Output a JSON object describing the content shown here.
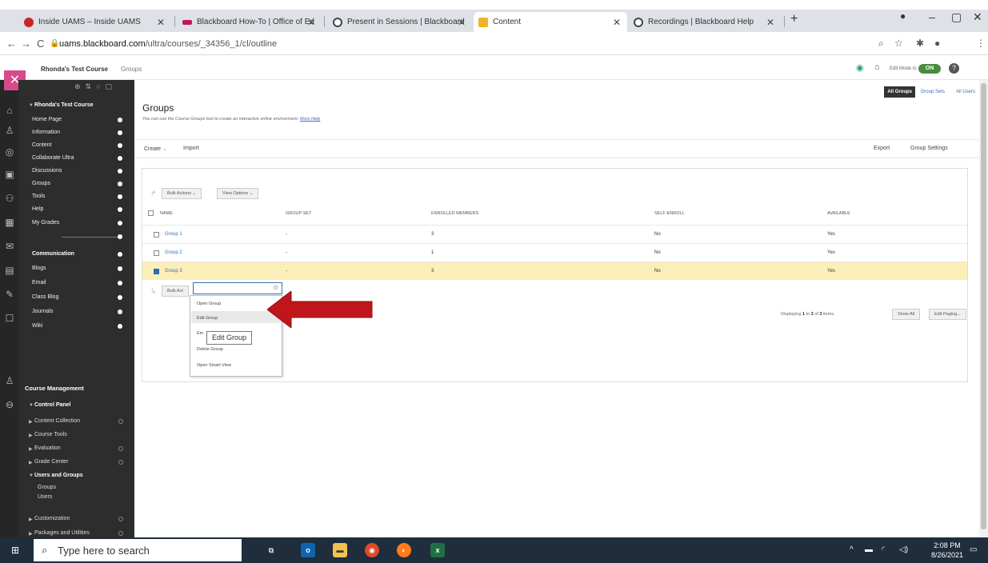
{
  "browser": {
    "tabs": [
      {
        "title": "Inside UAMS – Inside UAMS",
        "favicon_color": "#c62828"
      },
      {
        "title": "Blackboard How-To | Office of Ed",
        "favicon_color": "#c2185b"
      },
      {
        "title": "Present in Sessions | Blackboard",
        "favicon_color": "#444444"
      },
      {
        "title": "Content",
        "favicon_color": "#f0b429"
      },
      {
        "title": "Recordings | Blackboard Help",
        "favicon_color": "#444444"
      }
    ],
    "url_host": "uams.blackboard.com",
    "url_path": "/ultra/courses/_34356_1/cl/outline"
  },
  "course_header": {
    "course_name": "Rhonda's Test Course",
    "breadcrumb": "Groups",
    "edit_mode_label": "Edit Mode is:",
    "edit_mode_state": "ON"
  },
  "course_menu": {
    "title": "Rhonda's Test Course",
    "items": [
      {
        "label": "Home Page"
      },
      {
        "label": "Information"
      },
      {
        "label": "Content"
      },
      {
        "label": "Collaborate Ultra"
      },
      {
        "label": "Discussions"
      },
      {
        "label": "Groups"
      },
      {
        "label": "Tools"
      },
      {
        "label": "Help"
      },
      {
        "label": "My Grades"
      }
    ],
    "communication": {
      "label": "Communication",
      "items": [
        {
          "label": "Blogs"
        },
        {
          "label": "Email"
        },
        {
          "label": "Class Blog"
        },
        {
          "label": "Journals"
        },
        {
          "label": "Wiki"
        }
      ]
    },
    "management": {
      "label": "Course Management",
      "control_panel": "Control Panel",
      "items": [
        {
          "label": "Content Collection"
        },
        {
          "label": "Course Tools"
        },
        {
          "label": "Evaluation"
        },
        {
          "label": "Grade Center"
        },
        {
          "label": "Users and Groups"
        }
      ],
      "sub_items": [
        {
          "label": "Groups"
        },
        {
          "label": "Users"
        }
      ],
      "customization": "Customization",
      "packages": "Packages and Utilities"
    }
  },
  "main": {
    "view_tabs": [
      {
        "label": "All Groups",
        "active": true
      },
      {
        "label": "Group Sets"
      },
      {
        "label": "All Users"
      }
    ],
    "title": "Groups",
    "description": "You can use the Course Groups tool to create an interactive online environment.",
    "more_help": "More Help",
    "action_bar": {
      "create": "Create",
      "import": "Import",
      "export": "Export",
      "group_settings": "Group Settings"
    },
    "bulk_actions": "Bulk Actions",
    "view_options": "View Options",
    "bulk_actions_short": "Bulk Act",
    "columns": [
      "NAME",
      "GROUP SET",
      "ENROLLED MEMBERS",
      "SELF-ENROLL",
      "AVAILABLE"
    ],
    "rows": [
      {
        "name": "Group 1",
        "group_set": "-",
        "enrolled": "3",
        "self_enroll": "No",
        "available": "Yes",
        "checked": false
      },
      {
        "name": "Group 2",
        "group_set": "-",
        "enrolled": "1",
        "self_enroll": "No",
        "available": "Yes",
        "checked": false
      },
      {
        "name": "Group 3",
        "group_set": "-",
        "enrolled": "3",
        "self_enroll": "No",
        "available": "Yes",
        "checked": true
      }
    ],
    "context_menu": {
      "items": [
        "Open Group",
        "Edit Group",
        "Em",
        "Delete Group",
        "Open Smart View"
      ],
      "tooltip": "Edit Group"
    },
    "displaying": {
      "prefix": "Displaying",
      "from": "1",
      "to_word": "to",
      "to": "3",
      "of_word": "of",
      "total": "3",
      "suffix": "items"
    },
    "show_all": "Show All",
    "edit_paging": "Edit Paging..."
  },
  "taskbar": {
    "search_placeholder": "Type here to search",
    "time": "2:08 PM",
    "date": "8/26/2021"
  },
  "colors": {
    "accent_link": "#3a6fb0",
    "selected_row": "#fbeeb8",
    "arrow": "#c0161b",
    "close_x": "#d64b8d"
  }
}
